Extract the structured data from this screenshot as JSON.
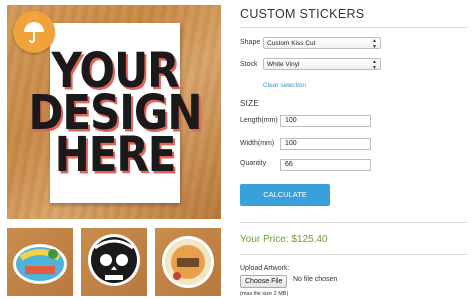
{
  "hero": {
    "lines": [
      "YOUR",
      "DESIGN",
      "HERE"
    ]
  },
  "thumbnails": [
    {
      "name": "surf-tacos-sticker"
    },
    {
      "name": "skull-sticker"
    },
    {
      "name": "circle-badge-sticker"
    }
  ],
  "product": {
    "title": "CUSTOM STICKERS",
    "shape_label": "Shape",
    "shape_value": "Custom Kiss Cut",
    "stock_label": "Stock",
    "stock_value": "White Vinyl",
    "clear_label": "Clear selection",
    "size_label": "SIZE",
    "length_label": "Length(mm)",
    "length_value": "100",
    "width_label": "Width(mm)",
    "width_value": "100",
    "quantity_label": "Quantity",
    "quantity_value": "66",
    "calculate_label": "CALCULATE",
    "price_text": "Your Price: $125.40"
  },
  "upload": {
    "label": "Upload Artwork:",
    "button_label": "Choose File",
    "status": "No file chosen",
    "hint": "(max file size 2 MB)"
  },
  "colors": {
    "accent": "#3aa0dc",
    "price": "#6d9c3c",
    "link": "#3a93c8",
    "badge": "#f2a23a"
  }
}
